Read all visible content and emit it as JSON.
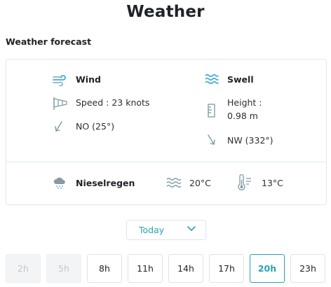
{
  "page": {
    "title": "Weather",
    "section_title": "Weather forecast"
  },
  "wind": {
    "title": "Wind",
    "speed": "Speed : 23 knots",
    "direction": "NO (25°)"
  },
  "swell": {
    "title": "Swell",
    "height_label": "Height :",
    "height_value": "0.98 m",
    "direction": "NW (332°)"
  },
  "conditions": {
    "weather": "Nieselregen",
    "water_temp": "20°C",
    "air_temp": "13°C"
  },
  "day_select": {
    "value": "Today"
  },
  "hours": [
    {
      "label": "2h",
      "state": "disabled"
    },
    {
      "label": "5h",
      "state": "disabled"
    },
    {
      "label": "8h",
      "state": "normal"
    },
    {
      "label": "11h",
      "state": "normal"
    },
    {
      "label": "14h",
      "state": "normal"
    },
    {
      "label": "17h",
      "state": "normal"
    },
    {
      "label": "20h",
      "state": "selected"
    },
    {
      "label": "23h",
      "state": "normal"
    }
  ],
  "colors": {
    "accent": "#2d9fb5",
    "icon": "#7e99a3",
    "border": "#e4e6e9"
  }
}
